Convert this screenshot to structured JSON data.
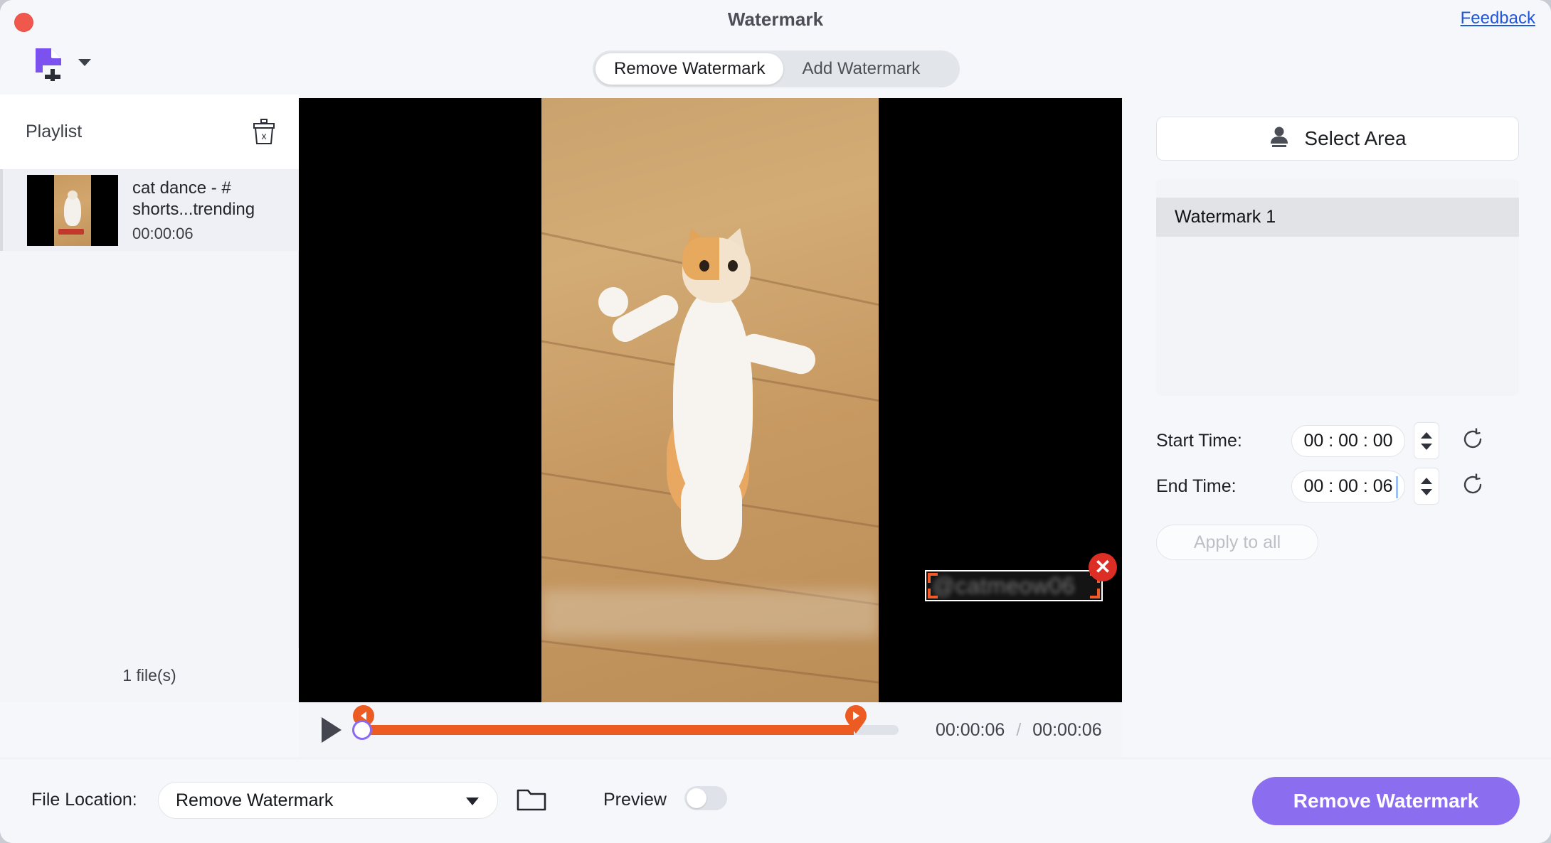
{
  "window": {
    "title": "Watermark",
    "feedback_label": "Feedback",
    "close_icon": "close-traffic-light",
    "add_file_icon": "add-file-icon",
    "chevron_icon": "chevron-down-icon"
  },
  "tabs": [
    {
      "label": "Remove Watermark",
      "active": true
    },
    {
      "label": "Add Watermark",
      "active": false
    }
  ],
  "playlist": {
    "title": "Playlist",
    "clear_icon": "trash-x-icon",
    "items": [
      {
        "name": "cat dance - # shorts...trending",
        "duration": "00:00:06",
        "thumbnail": "video-thumbnail"
      }
    ],
    "file_count": "1 file(s)"
  },
  "preview": {
    "watermark_box_text": "@catmeow06",
    "delete_icon": "close-circle-icon"
  },
  "player": {
    "play_icon": "play-icon",
    "current_time": "00:00:06",
    "separator": "/",
    "total_time": "00:00:06",
    "trim_start_icon": "trim-start-marker",
    "trim_end_icon": "trim-end-marker",
    "playhead_icon": "playhead-handle"
  },
  "rightpanel": {
    "select_area_label": "Select Area",
    "select_area_icon": "stamp-person-icon",
    "watermark_list": [
      {
        "label": "Watermark 1",
        "selected": true
      }
    ],
    "start_time": {
      "label": "Start Time:",
      "value": "00 : 00 : 00",
      "reset_icon": "reset-icon",
      "stepper_icon": "stepper-updown-icon"
    },
    "end_time": {
      "label": "End Time:",
      "value": "00 : 00 : 06",
      "reset_icon": "reset-icon",
      "stepper_icon": "stepper-updown-icon"
    },
    "apply_to_all_label": "Apply to all"
  },
  "bottombar": {
    "file_location_label": "File Location:",
    "file_location_value": "Remove Watermark",
    "folder_icon": "folder-icon",
    "preview_label": "Preview",
    "preview_enabled": false,
    "primary_button_label": "Remove Watermark"
  },
  "colors": {
    "accent_purple": "#8b6def",
    "timeline_orange": "#ec5b22",
    "delete_red": "#dd2e26",
    "link_blue": "#1f56e0",
    "traffic_red": "#f0584e"
  }
}
